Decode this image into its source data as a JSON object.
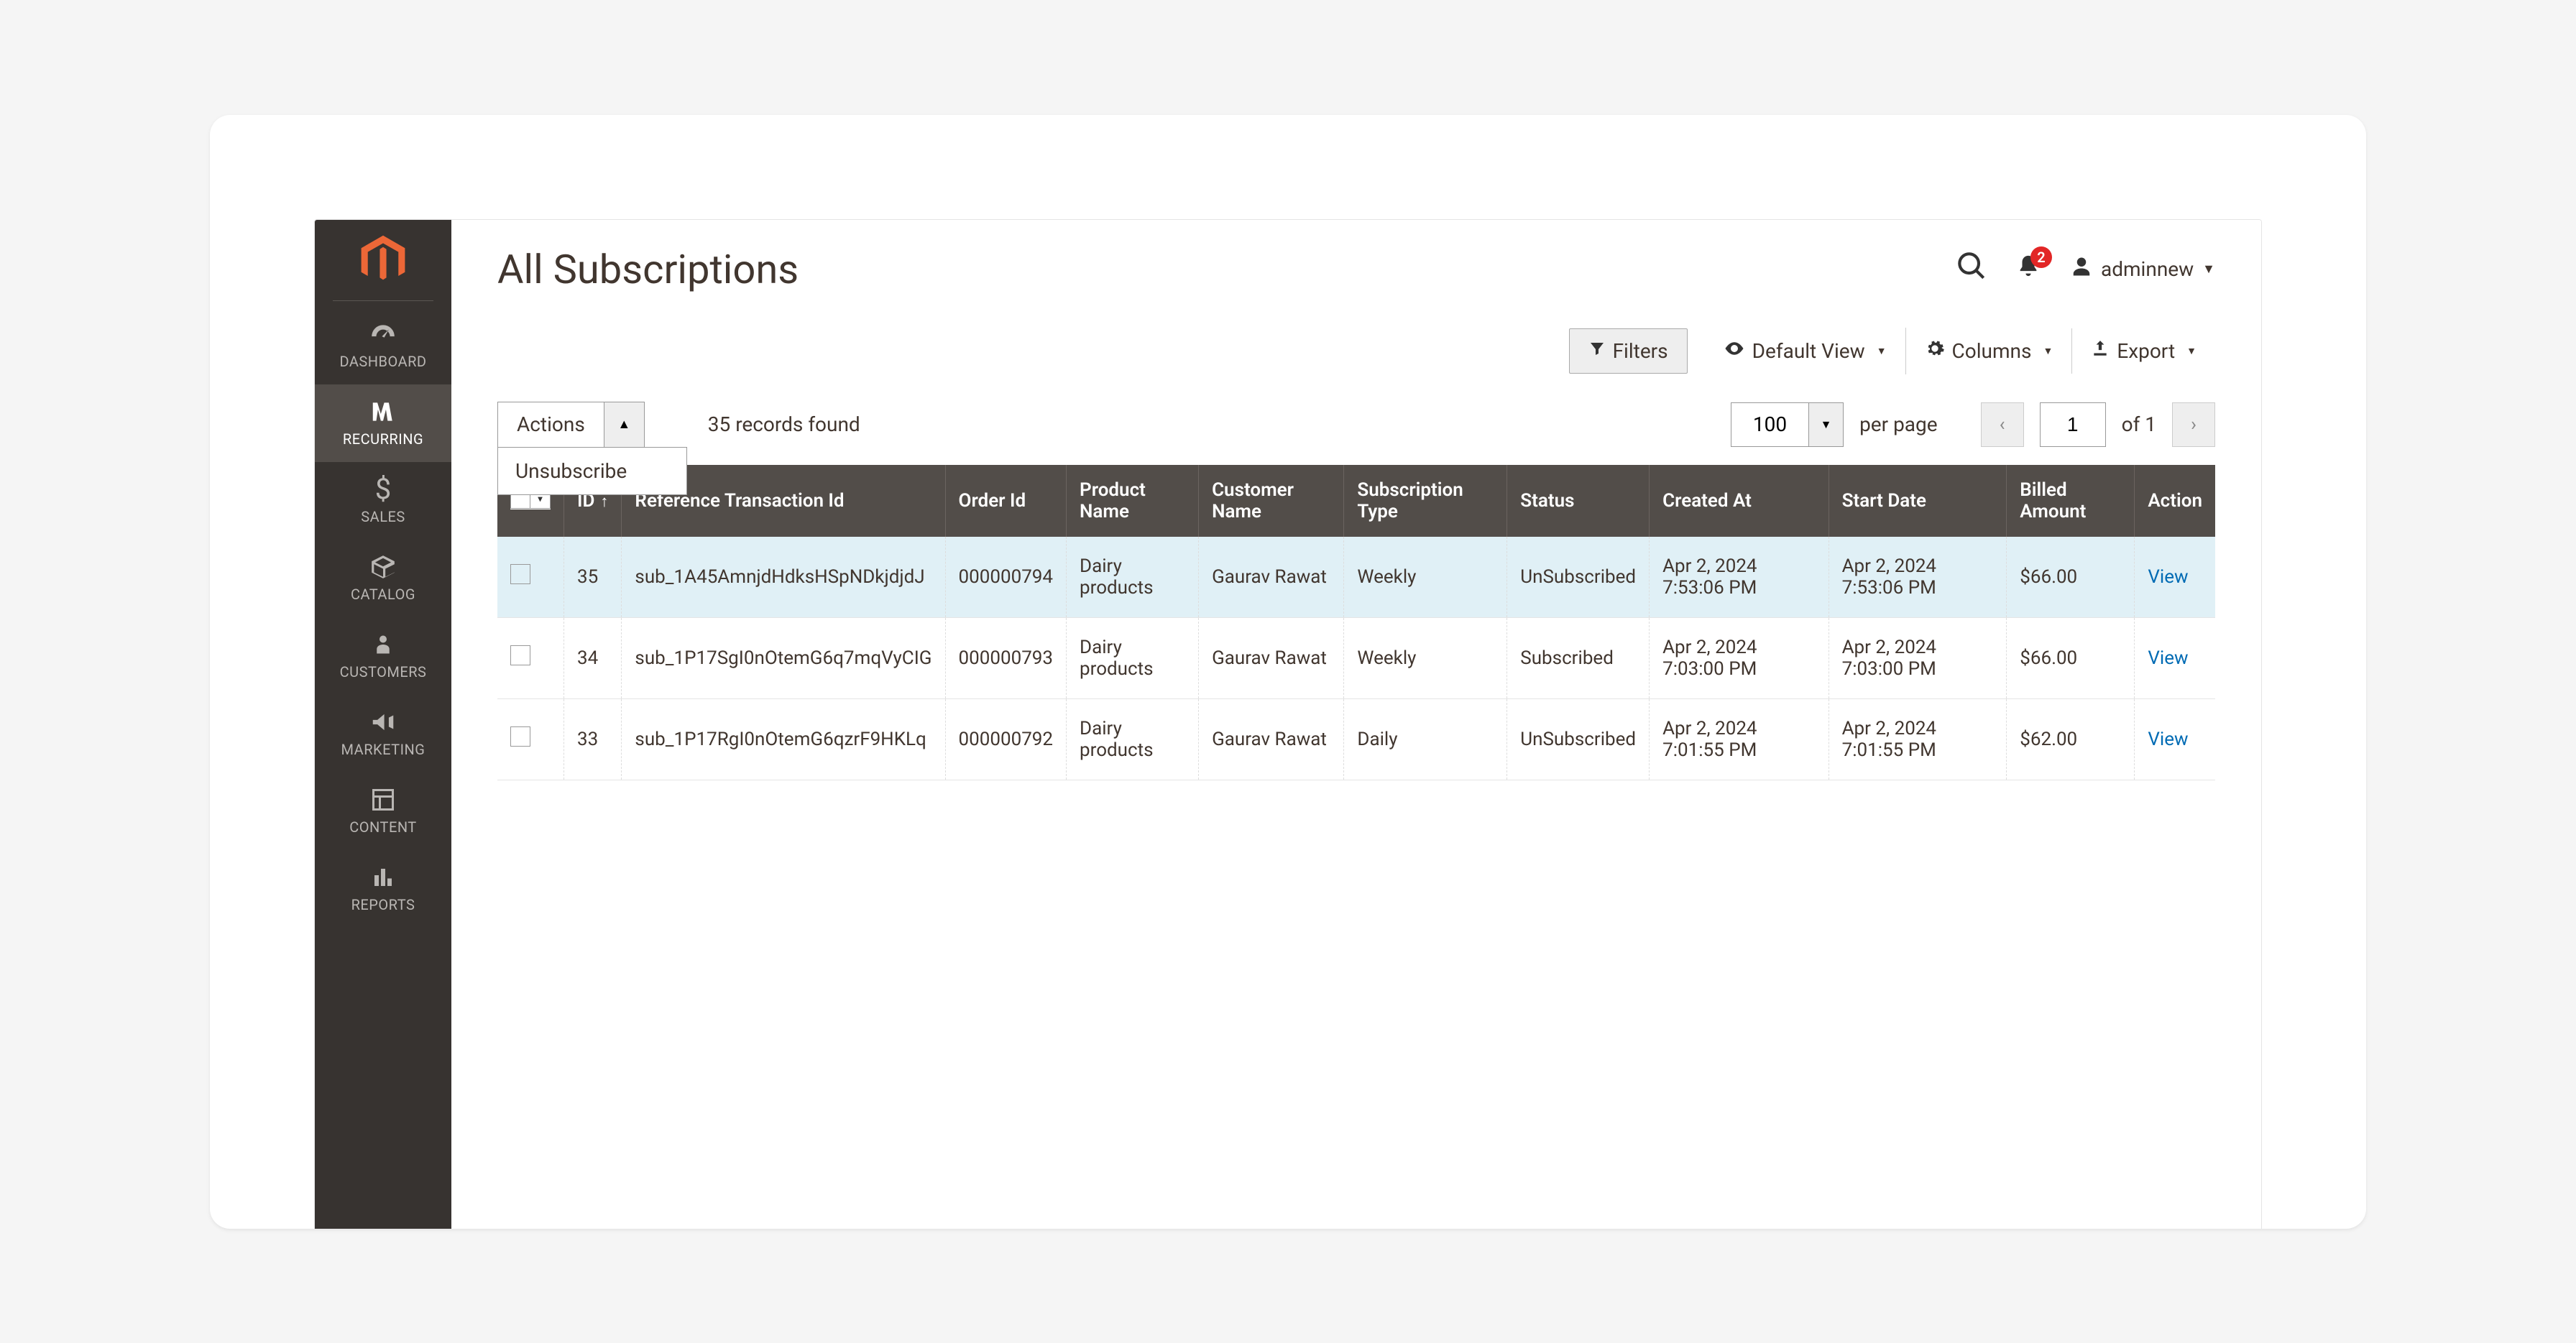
{
  "sidebar": {
    "items": [
      {
        "label": "DASHBOARD"
      },
      {
        "label": "RECURRING"
      },
      {
        "label": "SALES"
      },
      {
        "label": "CATALOG"
      },
      {
        "label": "CUSTOMERS"
      },
      {
        "label": "MARKETING"
      },
      {
        "label": "CONTENT"
      },
      {
        "label": "REPORTS"
      }
    ]
  },
  "header": {
    "title": "All Subscriptions",
    "notifications_count": "2",
    "user_name": "adminnew"
  },
  "toolbar": {
    "filters": "Filters",
    "default_view": "Default View",
    "columns": "Columns",
    "export": "Export"
  },
  "controls": {
    "actions_label": "Actions",
    "actions_menu": [
      "Unsubscribe"
    ],
    "records_found": "35 records found",
    "per_page_value": "100",
    "per_page_label": "per page",
    "page_current": "1",
    "of_pages": "of 1"
  },
  "grid": {
    "columns": [
      "ID",
      "Reference Transaction Id",
      "Order Id",
      "Product Name",
      "Customer Name",
      "Subscription Type",
      "Status",
      "Created At",
      "Start Date",
      "Billed Amount",
      "Action"
    ],
    "rows": [
      {
        "id": "35",
        "ref": "sub_1A45AmnjdHdksHSpNDkjdjdJ",
        "order": "000000794",
        "product": "Dairy products",
        "customer": "Gaurav Rawat",
        "subtype": "Weekly",
        "status": "UnSubscribed",
        "created": "Apr 2, 2024 7:53:06 PM",
        "start": "Apr 2, 2024 7:53:06 PM",
        "amount": "$66.00",
        "action": "View"
      },
      {
        "id": "34",
        "ref": "sub_1P17SgI0nOtemG6q7mqVyCIG",
        "order": "000000793",
        "product": "Dairy products",
        "customer": "Gaurav Rawat",
        "subtype": "Weekly",
        "status": "Subscribed",
        "created": "Apr 2, 2024 7:03:00 PM",
        "start": "Apr 2, 2024 7:03:00 PM",
        "amount": "$66.00",
        "action": "View"
      },
      {
        "id": "33",
        "ref": "sub_1P17RgI0nOtemG6qzrF9HKLq",
        "order": "000000792",
        "product": "Dairy products",
        "customer": "Gaurav Rawat",
        "subtype": "Daily",
        "status": "UnSubscribed",
        "created": "Apr 2, 2024 7:01:55 PM",
        "start": "Apr 2, 2024 7:01:55 PM",
        "amount": "$62.00",
        "action": "View"
      }
    ]
  }
}
